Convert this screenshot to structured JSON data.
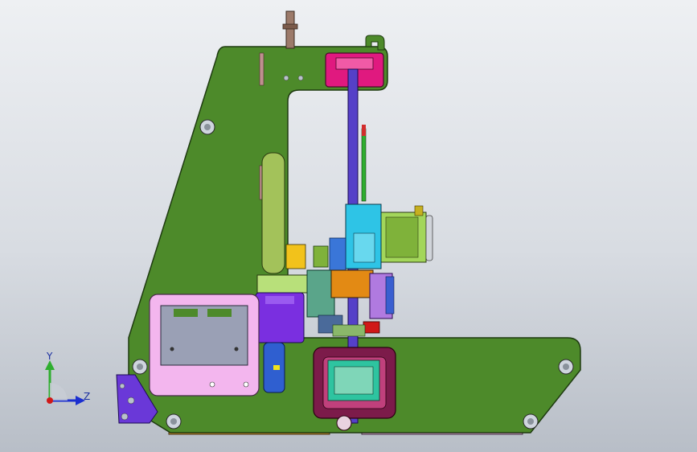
{
  "viewport": {
    "background_top": "#eef0f3",
    "background_bottom": "#b8bec7"
  },
  "triad": {
    "y_label": "Y",
    "z_label": "Z",
    "y_color": "#2fae2f",
    "z_color": "#1b2fd0",
    "origin_color": "#d01818"
  },
  "colors": {
    "frame": "#4d8a2a",
    "rod": "#5540c8",
    "top_block": "#e0197f",
    "motor": "#a3d65a",
    "lcd_panel": "#f3b6ee",
    "lcd_screen": "#9aa0b5",
    "carriage": "#e38a14",
    "base_bar": "#e89a2f",
    "base_bar_right": "#e9a8e0",
    "bottom_motor": "#7c1b4a",
    "cyan_parts": "#2ec4e6",
    "purple_block": "#7a2fe0"
  }
}
